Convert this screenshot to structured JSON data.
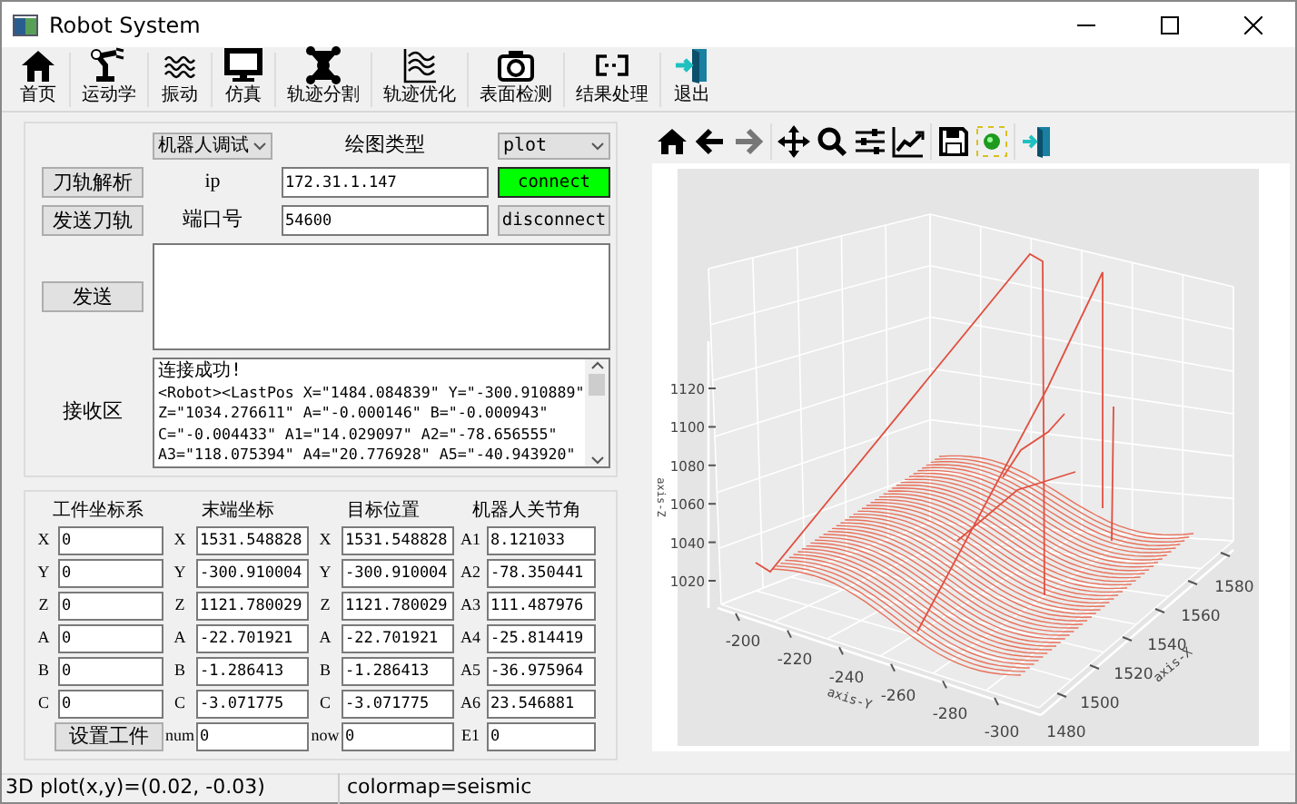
{
  "window": {
    "title": "Robot System"
  },
  "toolbar": [
    {
      "label": "首页"
    },
    {
      "label": "运动学"
    },
    {
      "label": "振动"
    },
    {
      "label": "仿真"
    },
    {
      "label": "轨迹分割"
    },
    {
      "label": "轨迹优化"
    },
    {
      "label": "表面检测"
    },
    {
      "label": "结果处理"
    },
    {
      "label": "退出"
    }
  ],
  "control_panel": {
    "mode_select": "机器人调试",
    "plot_type_label": "绘图类型",
    "plot_type_select": "plot",
    "parse_button": "刀轨解析",
    "ip_label": "ip",
    "ip_value": "172.31.1.147",
    "connect_button": {
      "label": "connect",
      "active": true
    },
    "send_path_button": "发送刀轨",
    "port_label": "端口号",
    "port_value": "54600",
    "disconnect_button": {
      "label": "disconnect",
      "active": false
    },
    "send_button": "发送",
    "receive_label": "接收区",
    "receive_status": "连接成功!",
    "receive_lines": [
      "<Robot><LastPos X=\"1484.084839\" Y=\"-300.910889\"",
      "Z=\"1034.276611\" A=\"-0.000146\" B=\"-0.000943\"",
      "C=\"-0.004433\" A1=\"14.029097\" A2=\"-78.656555\"",
      "A3=\"118.075394\" A4=\"20.776928\" A5=\"-40.943920\""
    ]
  },
  "coordinates": {
    "headers": [
      "工件坐标系",
      "末端坐标",
      "目标位置",
      "机器人关节角"
    ],
    "rows": [
      {
        "cells": [
          {
            "label": "X",
            "value": "0"
          },
          {
            "label": "X",
            "value": "1531.548828"
          },
          {
            "label": "X",
            "value": "1531.548828"
          },
          {
            "label": "A1",
            "value": "8.121033"
          }
        ]
      },
      {
        "cells": [
          {
            "label": "Y",
            "value": "0"
          },
          {
            "label": "Y",
            "value": "-300.910004"
          },
          {
            "label": "Y",
            "value": "-300.910004"
          },
          {
            "label": "A2",
            "value": "-78.350441"
          }
        ]
      },
      {
        "cells": [
          {
            "label": "Z",
            "value": "0"
          },
          {
            "label": "Z",
            "value": "1121.780029"
          },
          {
            "label": "Z",
            "value": "1121.780029"
          },
          {
            "label": "A3",
            "value": "111.487976"
          }
        ]
      },
      {
        "cells": [
          {
            "label": "A",
            "value": "0"
          },
          {
            "label": "A",
            "value": "-22.701921"
          },
          {
            "label": "A",
            "value": "-22.701921"
          },
          {
            "label": "A4",
            "value": "-25.814419"
          }
        ]
      },
      {
        "cells": [
          {
            "label": "B",
            "value": "0"
          },
          {
            "label": "B",
            "value": "-1.286413"
          },
          {
            "label": "B",
            "value": "-1.286413"
          },
          {
            "label": "A5",
            "value": "-36.975964"
          }
        ]
      },
      {
        "cells": [
          {
            "label": "C",
            "value": "0"
          },
          {
            "label": "C",
            "value": "-3.071775"
          },
          {
            "label": "C",
            "value": "-3.071775"
          },
          {
            "label": "A6",
            "value": "23.546881"
          }
        ]
      }
    ],
    "footer": {
      "set_button": "设置工件",
      "num_label": "num",
      "num_value": "0",
      "now_label": "now",
      "now_value": "0",
      "e1_label": "E1",
      "e1_value": "0"
    }
  },
  "plot": {
    "z_label": "axis-Z",
    "y_label": "axis-Y",
    "x_label": "axis-X",
    "z_ticks": [
      "1120",
      "1100",
      "1080",
      "1060",
      "1040",
      "1020"
    ],
    "y_ticks": [
      "-200",
      "-220",
      "-240",
      "-260",
      "-280",
      "-300"
    ],
    "x_ticks": [
      "1480",
      "1500",
      "1520",
      "1540",
      "1560",
      "1580"
    ]
  },
  "status_bar": [
    "3D plot(x,y)=(0.02, -0.03)",
    "colormap=seismic"
  ]
}
